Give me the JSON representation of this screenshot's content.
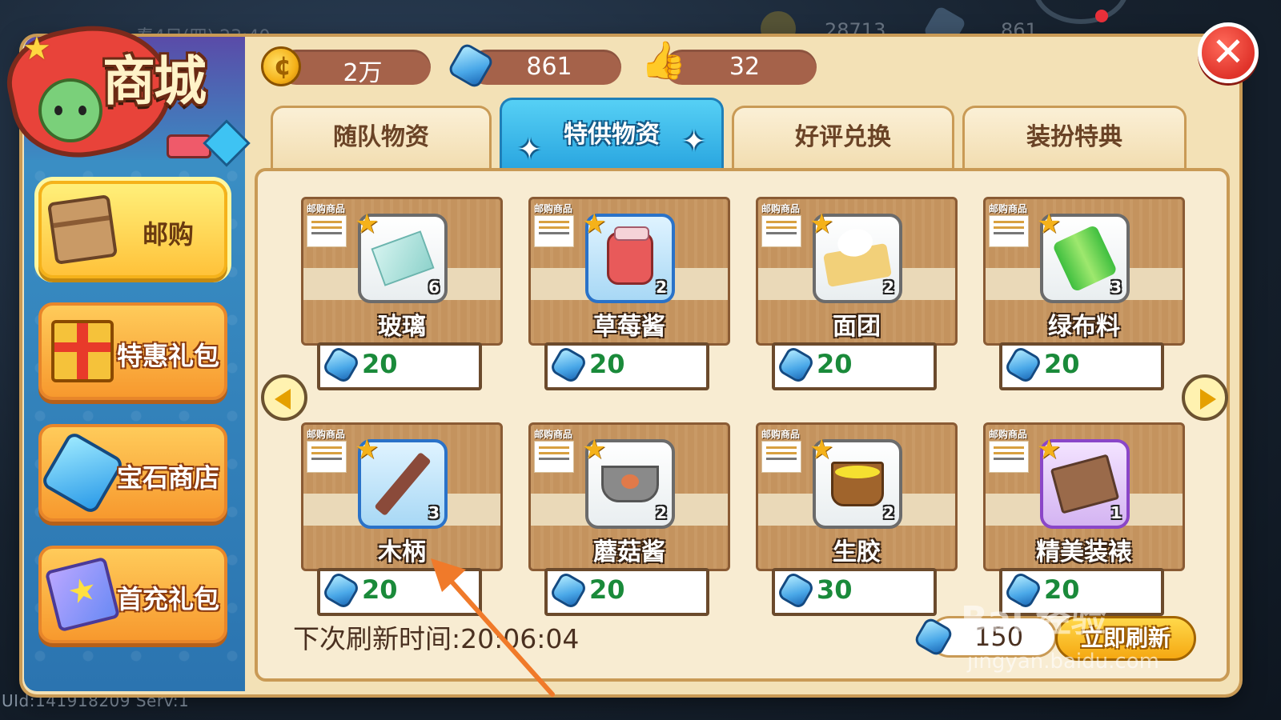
{
  "status_bar": {
    "date_time": "春4日(四) 23:40",
    "gold_value": "28713",
    "gem_value": "861"
  },
  "uid_label": "UId:141918209 Serv:1",
  "shop": {
    "title": "商城",
    "currencies": {
      "gold": "2万",
      "gems": "861",
      "likes": "32"
    },
    "close_symbol": "✕",
    "tabs": [
      {
        "label": "随队物资",
        "active": false
      },
      {
        "label": "特供物资",
        "active": true
      },
      {
        "label": "好评兑换",
        "active": false
      },
      {
        "label": "装扮特典",
        "active": false
      }
    ],
    "sidebar": [
      {
        "label": "邮购",
        "icon": "box-icon",
        "active": true
      },
      {
        "label": "特惠礼包",
        "icon": "gift-icon",
        "active": false
      },
      {
        "label": "宝石商店",
        "icon": "gem-icon",
        "active": false
      },
      {
        "label": "首充礼包",
        "icon": "star-card-icon",
        "active": false
      }
    ],
    "card_tag": "邮购商品",
    "items": [
      {
        "name": "玻璃",
        "qty": "6",
        "price": "20",
        "icon": "glass-icon",
        "frame": "gray"
      },
      {
        "name": "草莓酱",
        "qty": "2",
        "price": "20",
        "icon": "strawberry-jam-icon",
        "frame": "blue"
      },
      {
        "name": "面团",
        "qty": "2",
        "price": "20",
        "icon": "dough-icon",
        "frame": "gray"
      },
      {
        "name": "绿布料",
        "qty": "3",
        "price": "20",
        "icon": "green-cloth-icon",
        "frame": "gray"
      },
      {
        "name": "木柄",
        "qty": "3",
        "price": "20",
        "icon": "wooden-handle-icon",
        "frame": "blue"
      },
      {
        "name": "蘑菇酱",
        "qty": "2",
        "price": "20",
        "icon": "mushroom-sauce-icon",
        "frame": "gray"
      },
      {
        "name": "生胶",
        "qty": "2",
        "price": "30",
        "icon": "raw-rubber-icon",
        "frame": "gray"
      },
      {
        "name": "精美装裱",
        "qty": "1",
        "price": "20",
        "icon": "fine-mounting-icon",
        "frame": "purple"
      }
    ],
    "refresh": {
      "timer": "下次刷新时间:20:06:04",
      "cost": "150",
      "button_label": "立即刷新"
    }
  },
  "watermark": {
    "logo_text": "Bai 经验",
    "url": "jingyan.baidu.com"
  },
  "colors": {
    "price_green": "#1a8a3a",
    "tab_active_blue": "#2aa6e0",
    "panel_blue": "#2b74b0",
    "annotation_orange": "#f07a2a"
  }
}
